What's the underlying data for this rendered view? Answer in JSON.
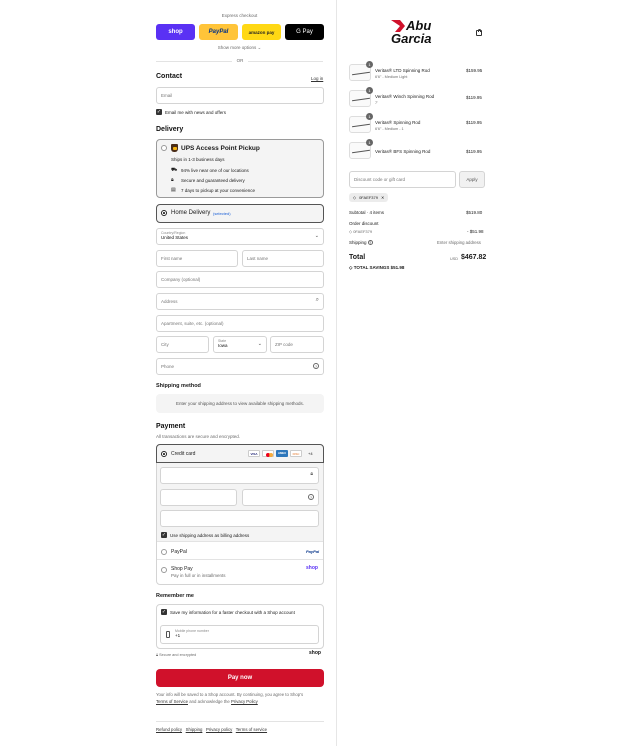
{
  "express": {
    "title": "Express checkout",
    "shop_label": "shop",
    "paypal_label": "PayPal",
    "amazon_label": "amazon pay",
    "gpay_label": "G Pay",
    "show_more": "Show more options",
    "or": "OR"
  },
  "contact": {
    "heading": "Contact",
    "login": "Log in",
    "email_placeholder": "Email",
    "news_label": "Email me with news and offers"
  },
  "delivery": {
    "heading": "Delivery",
    "ups_title": "UPS Access Point Pickup",
    "ups_lines": [
      "Ships in 1-3 business days",
      "94% live near one of our locations",
      "Secure and guaranteed delivery",
      "7 days to pickup at your convenience"
    ],
    "home_label": "Home Delivery",
    "home_badge": "(selected)",
    "country_label": "Country/Region",
    "country_value": "United States",
    "first_name": "First name",
    "last_name": "Last name",
    "company": "Company (optional)",
    "address": "Address",
    "apartment": "Apartment, suite, etc. (optional)",
    "city": "City",
    "state_label": "State",
    "state_value": "Iowa",
    "zip": "ZIP code",
    "phone": "Phone"
  },
  "shipping": {
    "heading": "Shipping method",
    "notice": "Enter your shipping address to view available shipping methods."
  },
  "payment": {
    "heading": "Payment",
    "subtitle": "All transactions are secure and encrypted.",
    "credit_card": "Credit card",
    "card_brands": [
      "VISA",
      "MC",
      "AMEX",
      "DISC"
    ],
    "more_brands": "+4",
    "billing_label": "Use shipping address as billing address",
    "paypal": "PayPal",
    "paypal_logo": "PayPal",
    "shop_pay": "Shop Pay",
    "shop_pay_sub": "Pay in full or in installments",
    "shop_logo": "shop"
  },
  "remember": {
    "heading": "Remember me",
    "save_label": "Save my information for a faster checkout with a Shop account",
    "mobile_label": "Mobile phone number",
    "mobile_value": "+1",
    "secure": "Secure and encrypted",
    "shop_logo": "shop"
  },
  "pay_now": "Pay now",
  "terms": {
    "line1": "Your info will be saved to a Shop account. By continuing, you agree to Shop's",
    "terms_link": "Terms of Service",
    "and_text": "and acknowledge the",
    "privacy_link": "Privacy Policy"
  },
  "footer_links": [
    "Refund policy",
    "Shipping",
    "Privacy policy",
    "Terms of service"
  ],
  "brand": {
    "line1": "Abu",
    "line2": "Garcia",
    "accent": "#d0112b"
  },
  "cart": {
    "items": [
      {
        "qty": "1",
        "name": "Veritas® LTD Spinning Rod",
        "variant": "6'6\" - Medium Light",
        "price": "$159.95"
      },
      {
        "qty": "1",
        "name": "Veritas® Winch Spinning Rod",
        "variant": "7'",
        "price": "$119.95"
      },
      {
        "qty": "1",
        "name": "Veritas® Spinning Rod",
        "variant": "6'6\" - Medium - 1",
        "price": "$119.95"
      },
      {
        "qty": "1",
        "name": "Veritas® BFS Spinning Rod",
        "variant": "",
        "price": "$119.95"
      }
    ],
    "discount_placeholder": "Discount code or gift card",
    "apply": "Apply",
    "code_chip": "0FAEF379",
    "subtotal_label": "Subtotal · 4 items",
    "subtotal_value": "$519.80",
    "order_discount_label": "Order discount",
    "order_discount_code": "0FAEF379",
    "order_discount_value": "- $51.98",
    "shipping_label": "Shipping",
    "shipping_value": "Enter shipping address",
    "total_label": "Total",
    "currency": "USD",
    "total_value": "$467.82",
    "savings_label": "TOTAL SAVINGS",
    "savings_value": "$51.98"
  },
  "colors": {
    "pay_button": "#d0112b",
    "shop": "#5a31f4",
    "paypal": "#ffc439",
    "amazon": "#ffd814",
    "link_blue": "#1a5fd6"
  }
}
